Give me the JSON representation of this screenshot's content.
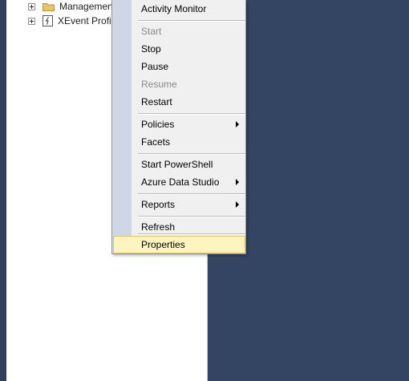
{
  "tree": {
    "items": [
      {
        "label": "Management"
      },
      {
        "label": "XEvent Profil"
      }
    ]
  },
  "menu": {
    "items": [
      {
        "label": "Activity Monitor"
      },
      {
        "label": "Start",
        "disabled": true
      },
      {
        "label": "Stop"
      },
      {
        "label": "Pause"
      },
      {
        "label": "Resume",
        "disabled": true
      },
      {
        "label": "Restart"
      },
      {
        "label": "Policies",
        "submenu": true
      },
      {
        "label": "Facets"
      },
      {
        "label": "Start PowerShell"
      },
      {
        "label": "Azure Data Studio",
        "submenu": true
      },
      {
        "label": "Reports",
        "submenu": true
      },
      {
        "label": "Refresh"
      },
      {
        "label": "Properties",
        "highlighted": true
      }
    ]
  },
  "colors": {
    "background_right": "#344563",
    "menu_background": "#f0f0f0",
    "menu_gutter": "#cfd6e5",
    "highlight_fill": "#fdf4bf",
    "highlight_border": "#e5c365",
    "disabled_text": "#8a8a8a"
  }
}
